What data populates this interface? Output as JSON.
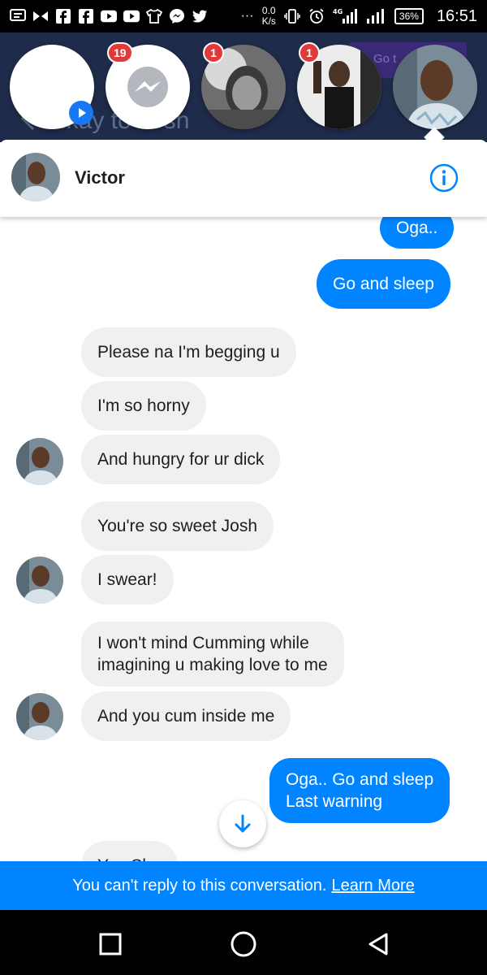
{
  "status_bar": {
    "left_icons": [
      "message-icon",
      "bowtie-icon",
      "facebook-icon",
      "facebook-icon",
      "youtube-icon",
      "youtube-icon",
      "shirt-icon",
      "messenger-icon",
      "twitter-icon"
    ],
    "more": "···",
    "speed_value": "0.0",
    "speed_unit": "K/s",
    "network": "4G",
    "battery": "36%",
    "time": "16:51"
  },
  "background_app": {
    "title": "Nkay to Josh",
    "button_label": "Go t"
  },
  "chat_heads": [
    {
      "name": "video-head",
      "badge": ""
    },
    {
      "name": "messenger-head",
      "badge": "19"
    },
    {
      "name": "contact-head-1",
      "badge": "1"
    },
    {
      "name": "contact-head-2",
      "badge": "1"
    },
    {
      "name": "victor-head",
      "badge": ""
    }
  ],
  "header": {
    "name": "Victor"
  },
  "messages": [
    {
      "side": "out",
      "text": "Oga.."
    },
    {
      "side": "out",
      "text": "Go and sleep"
    },
    {
      "side": "in",
      "text": "Please na I'm begging u"
    },
    {
      "side": "in",
      "text": "I'm so horny"
    },
    {
      "side": "in",
      "text": "And hungry for ur dick"
    },
    {
      "side": "in",
      "text": "You're so sweet Josh"
    },
    {
      "side": "in",
      "text": "I swear!"
    },
    {
      "side": "in",
      "text": "I won't mind Cumming while"
    },
    {
      "side": "in",
      "text": "imagining u making love to me"
    },
    {
      "side": "in",
      "text": "And you cum inside me"
    },
    {
      "side": "out",
      "text": "Oga.. Go and sleep"
    },
    {
      "side": "out",
      "text": "Last warning"
    },
    {
      "side": "in",
      "text": "You Sho"
    }
  ],
  "banner": {
    "text": "You can't reply to this conversation.",
    "link": "Learn More"
  },
  "colors": {
    "accent": "#0084ff",
    "incoming_bubble": "#f0f0f0",
    "badge": "#e03b3b",
    "background_app": "#1f2b4a"
  }
}
